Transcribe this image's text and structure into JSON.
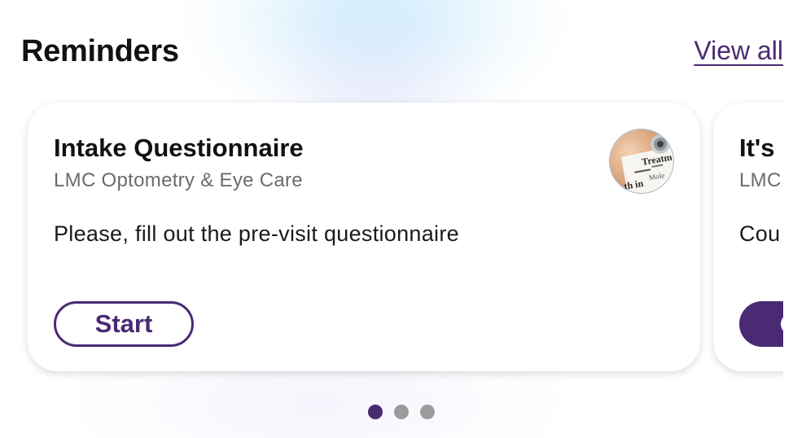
{
  "section": {
    "title": "Reminders",
    "view_all_label": "View all"
  },
  "cards": [
    {
      "title": "Intake Questionnaire",
      "provider": "LMC Optometry & Eye Care",
      "message": "Please, fill out the pre-visit questionnaire",
      "action_label": "Start",
      "avatar_icon": "prescription-document-photo"
    },
    {
      "title": "It's",
      "provider": "LMC",
      "message": "Cou",
      "action_label": ""
    }
  ],
  "pagination": {
    "total": 3,
    "active_index": 0
  },
  "colors": {
    "accent": "#4a2a72",
    "inactive_dot": "#9b9b9b"
  }
}
